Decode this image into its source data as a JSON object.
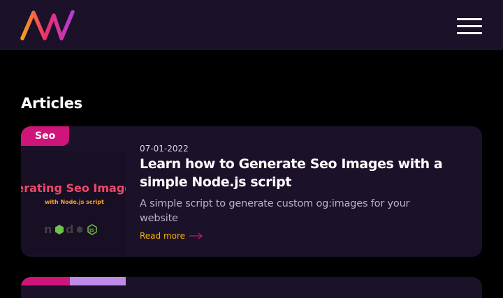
{
  "header": {
    "logo_icon": "aw-logo-icon",
    "menu_icon": "hamburger-menu-icon"
  },
  "main": {
    "section_title": "Articles",
    "articles": [
      {
        "tag": "Seo",
        "date": "07-01-2022",
        "title": "Learn how to Generate Seo Images with a simple Node.js script",
        "description": "A simple script to generate custom og:images for your website",
        "read_more": "Read more",
        "thumbnail": {
          "title": "Generating Seo Images",
          "subtitle": "with Node.js script",
          "logo_icon": "nodejs-logo-icon"
        }
      }
    ]
  },
  "colors": {
    "background": "#000000",
    "header_bg": "#1b1128",
    "card_bg": "#1b1128",
    "tag_pink": "#d0157a",
    "tag_lavender": "#c08be8",
    "read_more": "#f5b20a"
  }
}
